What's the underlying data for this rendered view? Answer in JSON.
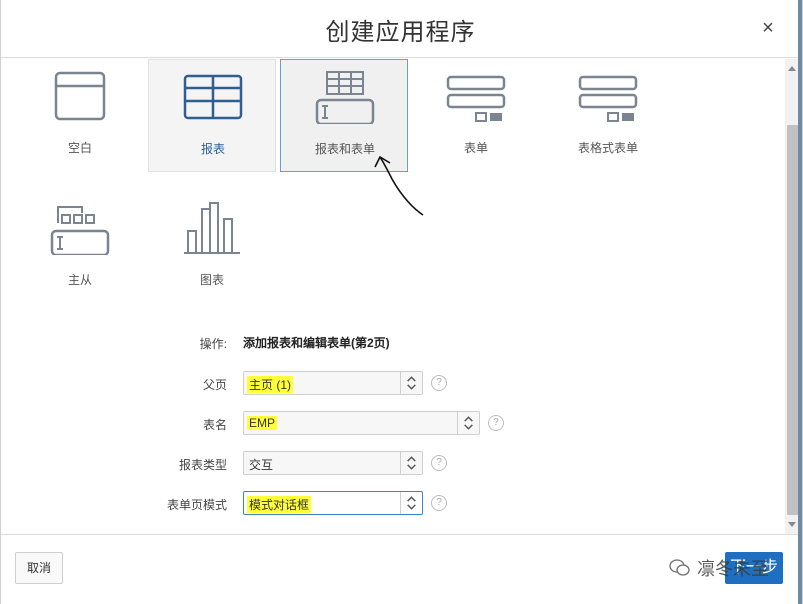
{
  "dialog": {
    "title": "创建应用程序",
    "close_symbol": "×"
  },
  "tiles": [
    {
      "label": "空白",
      "icon": "blank-page-icon"
    },
    {
      "label": "报表",
      "icon": "report-grid-icon"
    },
    {
      "label": "报表和表单",
      "icon": "report-and-form-icon"
    },
    {
      "label": "表单",
      "icon": "form-icon"
    },
    {
      "label": "表格式表单",
      "icon": "tabular-form-icon"
    },
    {
      "label": "主从",
      "icon": "master-detail-icon"
    },
    {
      "label": "图表",
      "icon": "bar-chart-icon"
    }
  ],
  "form": {
    "action_label": "操作:",
    "action_value": "添加报表和编辑表单(第2页)",
    "parent_label": "父页",
    "parent_value": "主页 (1)",
    "table_label": "表名",
    "table_value": "EMP",
    "report_type_label": "报表类型",
    "report_type_value": "交互",
    "form_mode_label": "表单页模式",
    "form_mode_value": "模式对话框",
    "help_symbol": "?"
  },
  "footer": {
    "cancel_label": "取消",
    "next_label": "下一步",
    "watermark_text": "凛冬未至"
  },
  "colors": {
    "accent": "#1e6fc0",
    "highlight": "#ffff3a",
    "icon_stroke": "#7a8591",
    "selected_text": "#2f5e8f"
  }
}
